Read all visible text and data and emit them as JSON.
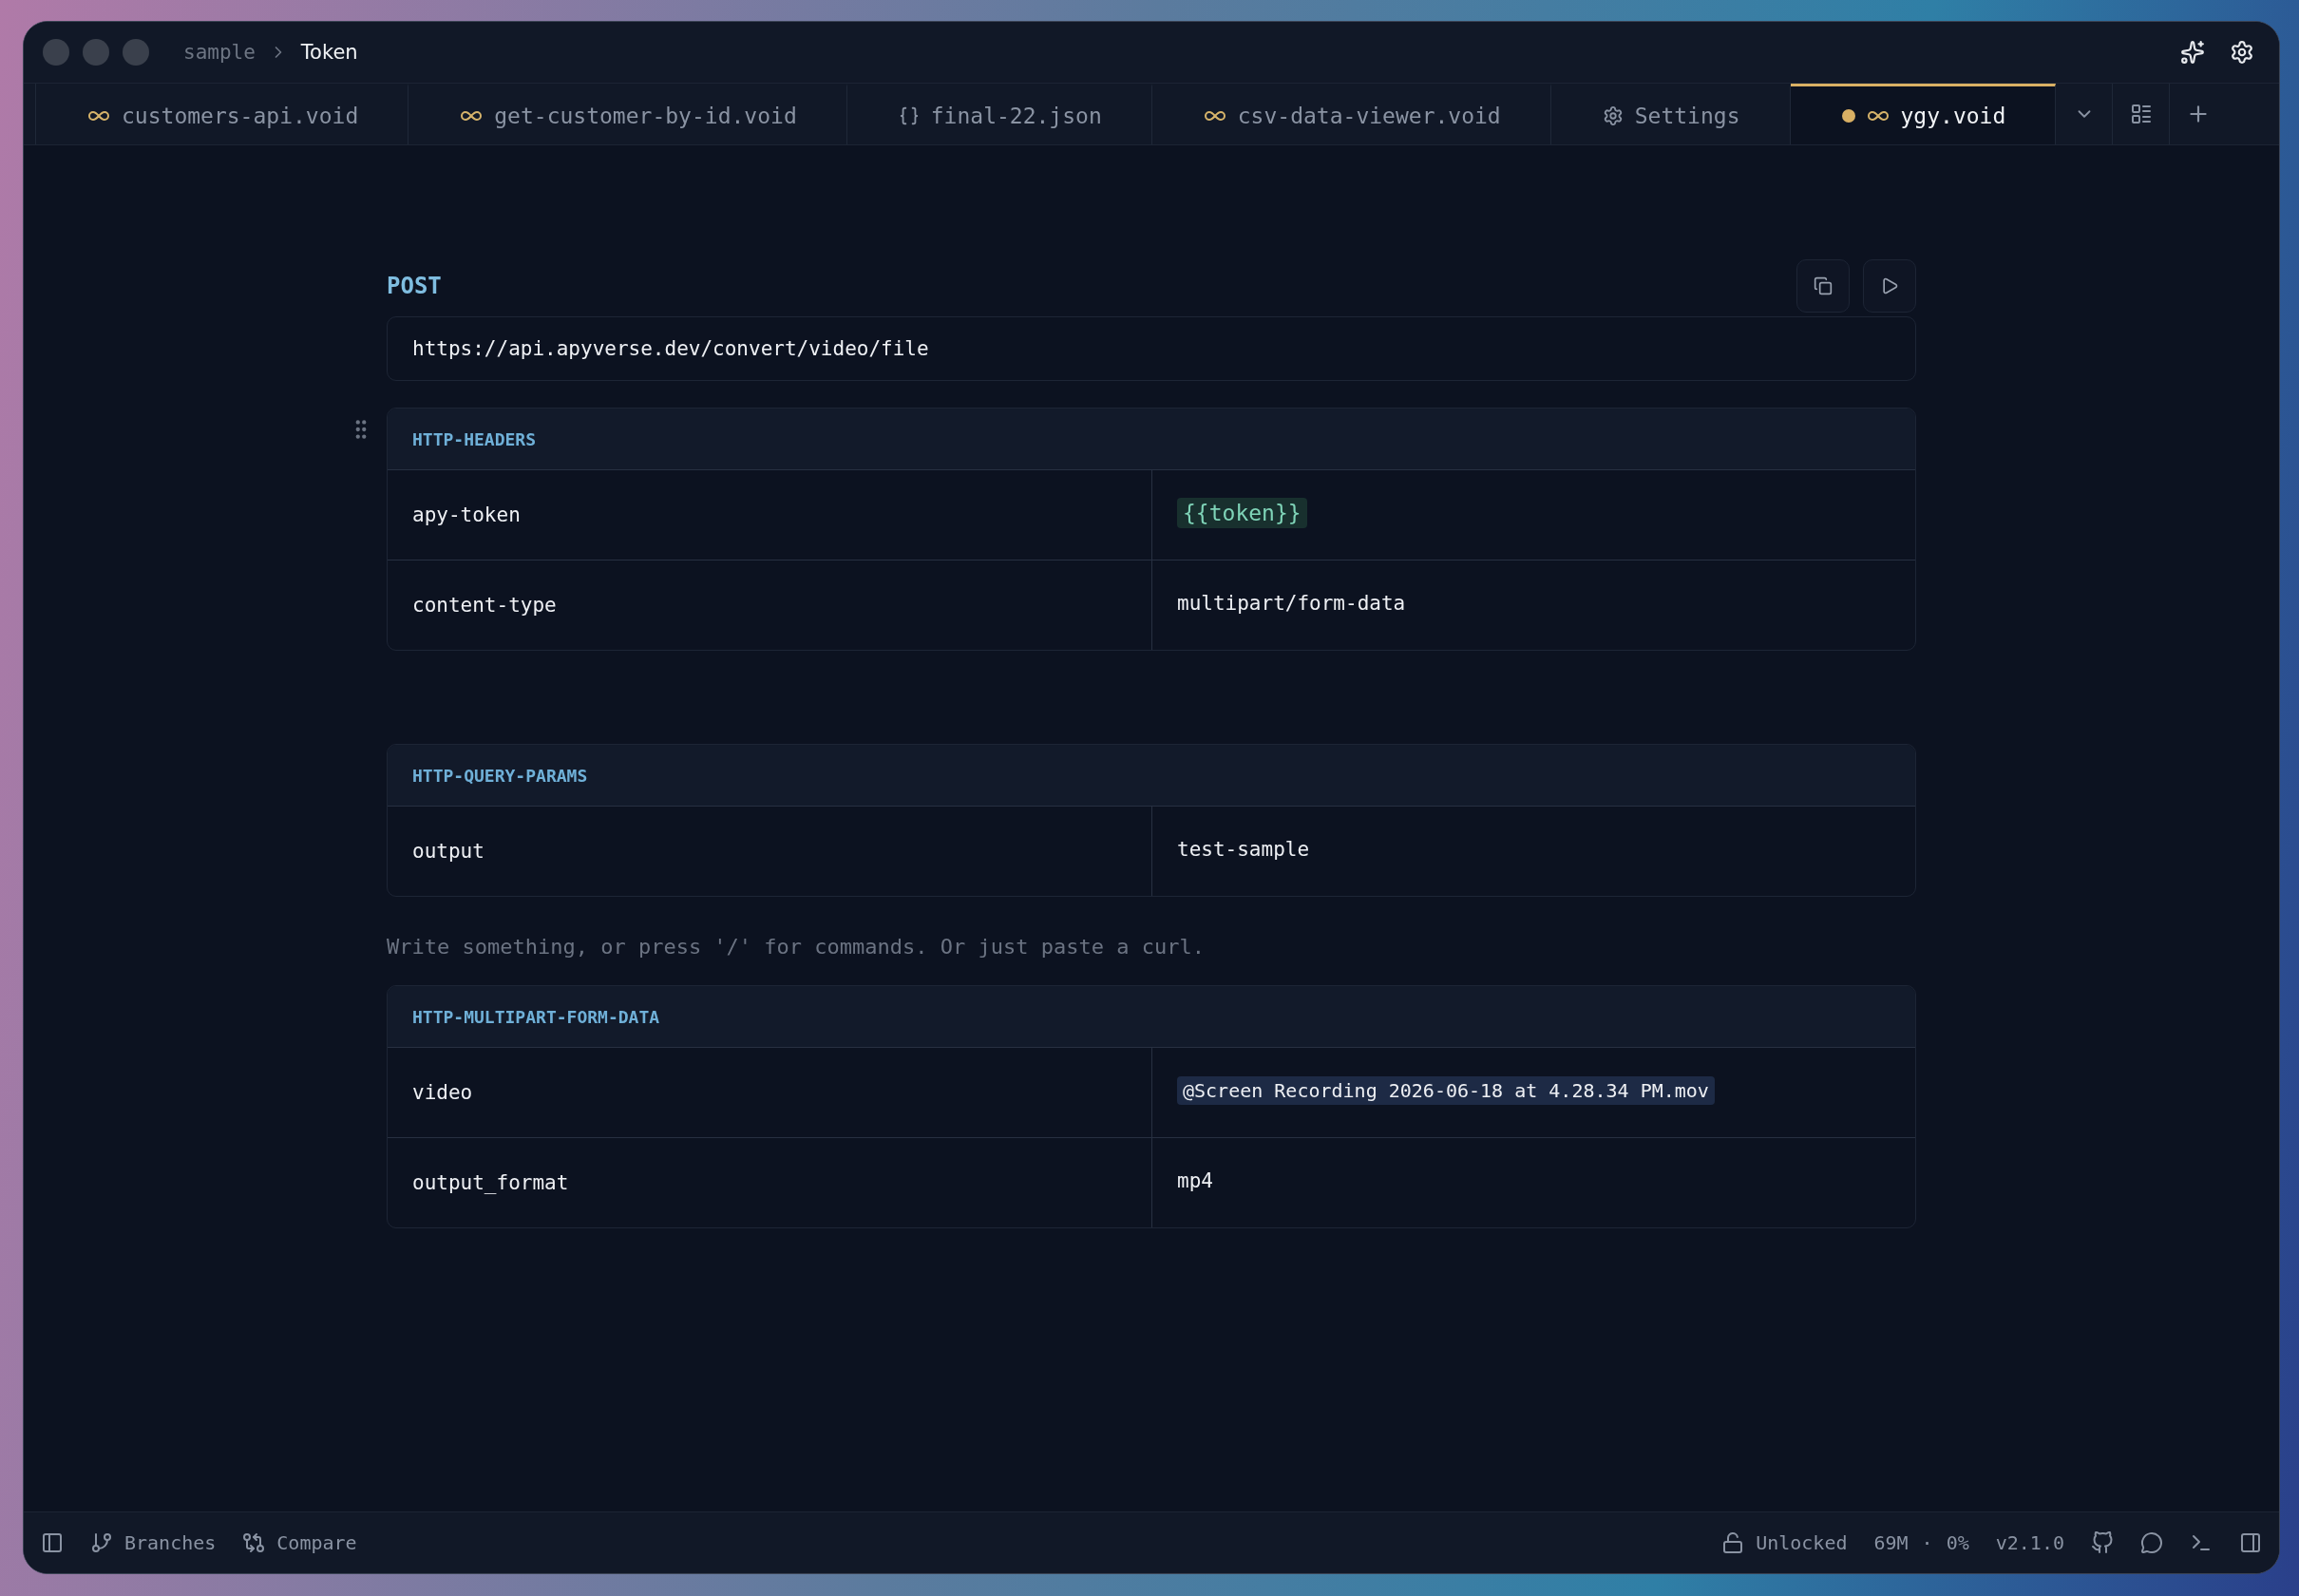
{
  "window": {
    "breadcrumb": [
      "sample",
      "Token"
    ]
  },
  "tabs": [
    {
      "label": "customers-api.void",
      "kind": "void",
      "selected": false,
      "modified": false
    },
    {
      "label": "get-customer-by-id.void",
      "kind": "void",
      "selected": false,
      "modified": false
    },
    {
      "label": "final-22.json",
      "kind": "json",
      "selected": false,
      "modified": false
    },
    {
      "label": "csv-data-viewer.void",
      "kind": "void",
      "selected": false,
      "modified": false
    },
    {
      "label": "Settings",
      "kind": "settings",
      "selected": false,
      "modified": false
    },
    {
      "label": "ygy.void",
      "kind": "void",
      "selected": true,
      "modified": true
    }
  ],
  "request": {
    "method": "POST",
    "url": "https://api.apyverse.dev/convert/video/file"
  },
  "content": [
    {
      "kind": "block",
      "title": "HTTP-HEADERS",
      "rows": [
        {
          "key": "apy-token",
          "value": "{{token}}",
          "kind": "variable"
        },
        {
          "key": "content-type",
          "value": "multipart/form-data",
          "kind": "text"
        }
      ]
    },
    {
      "kind": "block",
      "title": "HTTP-QUERY-PARAMS",
      "rows": [
        {
          "key": "output",
          "value": "test-sample",
          "kind": "text"
        }
      ]
    },
    {
      "kind": "empty_line",
      "placeholder": "Write something, or press '/' for commands. Or just paste a curl."
    },
    {
      "kind": "block",
      "title": "HTTP-MULTIPART-FORM-DATA",
      "rows": [
        {
          "key": "video",
          "value": "@Screen Recording 2026-06-18 at 4.28.34 PM.mov",
          "kind": "file"
        },
        {
          "key": "output_format",
          "value": "mp4",
          "kind": "text"
        }
      ]
    }
  ],
  "status_bar": {
    "left": [
      "Branches",
      "Compare"
    ],
    "lock": "Unlocked",
    "memory": "69M",
    "separator": "·",
    "cpu": "0%",
    "version": "v2.1.0"
  }
}
